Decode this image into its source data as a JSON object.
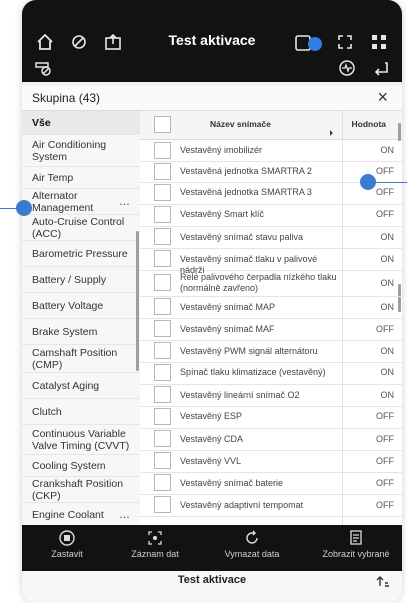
{
  "app": {
    "title": "Test aktivace"
  },
  "group": {
    "label": "Skupina (43)",
    "close": "×"
  },
  "sidebar": {
    "items": [
      {
        "label": "Vše",
        "selected": true
      },
      {
        "label": "Air Conditioning System"
      },
      {
        "label": "Air Temp"
      },
      {
        "label": "Alternator Management",
        "more": "…"
      },
      {
        "label": "Auto-Cruise Control (ACC)"
      },
      {
        "label": "Barometric Pressure"
      },
      {
        "label": "Battery / Supply"
      },
      {
        "label": "Battery Voltage"
      },
      {
        "label": "Brake System"
      },
      {
        "label": "Camshaft Position (CMP)"
      },
      {
        "label": "Catalyst Aging"
      },
      {
        "label": "Clutch"
      },
      {
        "label": "Continuous Variable Valve Timing (CVVT)"
      },
      {
        "label": "Cooling System"
      },
      {
        "label": "Crankshaft Position (CKP)"
      },
      {
        "label": "Engine Coolant",
        "more": "…"
      }
    ]
  },
  "table": {
    "headers": {
      "name": "Název snímače",
      "value": "Hodnota"
    },
    "rows": [
      {
        "name": "Vestavěný imobilizér",
        "value": "ON"
      },
      {
        "name": "Vestavěná jednotka SMARTRA 2",
        "value": "OFF"
      },
      {
        "name": "Vestavěná jednotka SMARTRA 3",
        "value": "OFF"
      },
      {
        "name": "Vestavěný Smart klíč",
        "value": "OFF"
      },
      {
        "name": "Vestavěný snímač stavu paliva",
        "value": "ON"
      },
      {
        "name": "Vestavěný snímač tlaku v palivové nádrži",
        "value": "ON"
      },
      {
        "name": "Relé palivového čerpadla nízkého tlaku (normálně zavřeno)",
        "value": "ON"
      },
      {
        "name": "Vestavěný snímač MAP",
        "value": "ON"
      },
      {
        "name": "Vestavěný snímač MAF",
        "value": "OFF"
      },
      {
        "name": "Vestavěný PWM signál alternátoru",
        "value": "ON"
      },
      {
        "name": "Spínač tlaku klimatizace (vestavěný)",
        "value": "ON"
      },
      {
        "name": "Vestavěný lineární snímač O2",
        "value": "ON"
      },
      {
        "name": "Vestavěný ESP",
        "value": "OFF"
      },
      {
        "name": "Vestavěný CDA",
        "value": "OFF"
      },
      {
        "name": "Vestavěný VVL",
        "value": "OFF"
      },
      {
        "name": "Vestavěný snímač baterie",
        "value": "OFF"
      },
      {
        "name": "Vestavěný adaptivní tempomat",
        "value": "OFF"
      }
    ]
  },
  "bottom": {
    "items": [
      {
        "label": "Zastavit",
        "icon": "stop-icon"
      },
      {
        "label": "Záznam dat",
        "icon": "record-icon"
      },
      {
        "label": "Vymazat data",
        "icon": "refresh-icon"
      },
      {
        "label": "Zobrazit vybrané",
        "icon": "display-selected-icon"
      }
    ]
  },
  "footer": {
    "title": "Test aktivace"
  },
  "colors": {
    "accent": "#3c7ad0",
    "topbar": "#121212",
    "badge": "#2f7de1"
  }
}
